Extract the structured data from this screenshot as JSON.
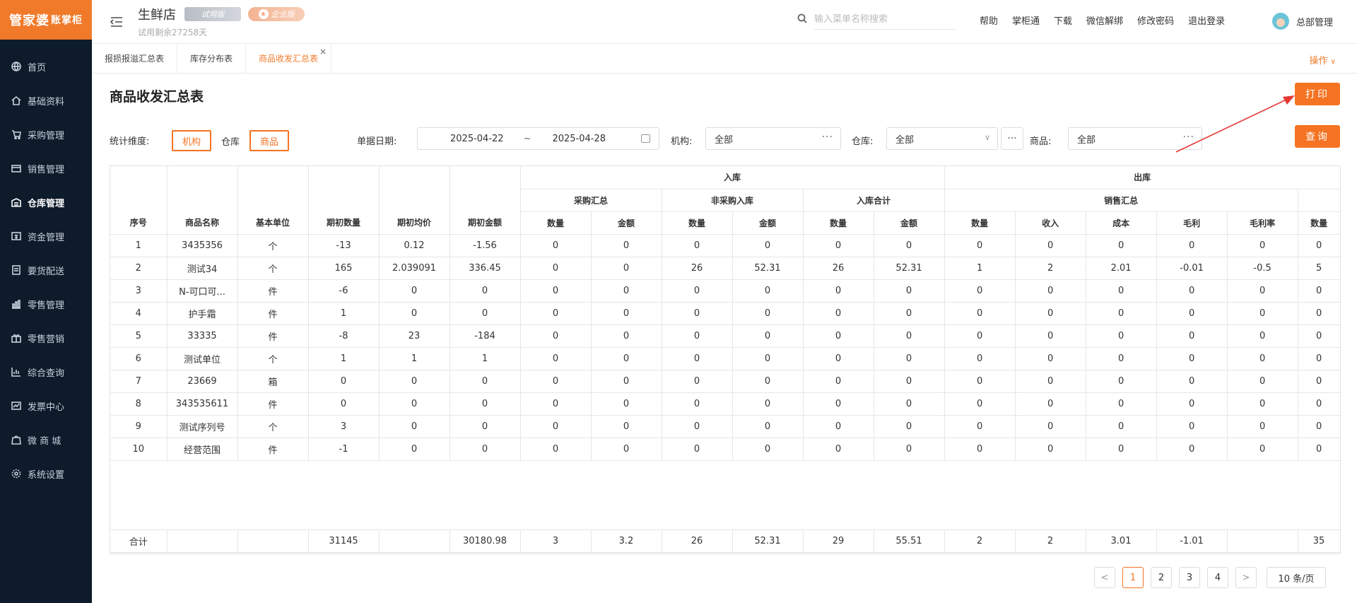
{
  "app": {
    "logo_main": "管家婆",
    "logo_sub": "账掌柜",
    "store_name": "生鲜店",
    "badge_trial": "试用版",
    "badge_pro": "企业版",
    "trial_days": "试用剩余27258天",
    "search_placeholder": "输入菜单名称搜索",
    "top_links": [
      "帮助",
      "掌柜通",
      "下载",
      "微信解绑",
      "修改密码",
      "退出登录"
    ],
    "user_name": "总部管理"
  },
  "sidebar": {
    "items": [
      {
        "label": "首页",
        "icon": "globe-icon"
      },
      {
        "label": "基础资料",
        "icon": "home-icon"
      },
      {
        "label": "采购管理",
        "icon": "cart-icon"
      },
      {
        "label": "销售管理",
        "icon": "sales-icon"
      },
      {
        "label": "仓库管理",
        "icon": "warehouse-icon"
      },
      {
        "label": "资金管理",
        "icon": "money-icon"
      },
      {
        "label": "要货配送",
        "icon": "delivery-icon"
      },
      {
        "label": "零售管理",
        "icon": "retail-icon"
      },
      {
        "label": "零售营销",
        "icon": "gift-icon"
      },
      {
        "label": "综合查询",
        "icon": "chart-icon"
      },
      {
        "label": "发票中心",
        "icon": "invoice-icon"
      },
      {
        "label": "微 商 城",
        "icon": "shop-icon"
      },
      {
        "label": "系统设置",
        "icon": "settings-icon"
      }
    ],
    "active_index": 4
  },
  "tabs": {
    "items": [
      "报损报溢汇总表",
      "库存分布表",
      "商品收发汇总表"
    ],
    "active_index": 2,
    "close_glyph": "×",
    "ops_label": "操作",
    "ops_chevron": "∨"
  },
  "page": {
    "title": "商品收发汇总表",
    "print_label": "打印",
    "query_label": "查询"
  },
  "filters": {
    "dimension_label": "统计维度:",
    "dimension_options": [
      "机构",
      "仓库",
      "商品"
    ],
    "dimension_selected": [
      0,
      2
    ],
    "date_label": "单据日期:",
    "date_start": "2025-04-22",
    "date_sep": "~",
    "date_end": "2025-04-28",
    "org_label": "机构:",
    "org_value": "全部",
    "warehouse_label": "仓库:",
    "warehouse_value": "全部",
    "product_label": "商品:",
    "product_value": "全部",
    "dots": "···"
  },
  "table": {
    "group_headers": {
      "inbound": "入库",
      "outbound": "出库",
      "purchase_summary": "采购汇总",
      "non_purchase_in": "非采购入库",
      "inbound_total": "入库合计",
      "sales_summary": "销售汇总"
    },
    "columns": [
      "序号",
      "商品名称",
      "基本单位",
      "期初数量",
      "期初均价",
      "期初金额",
      "数量",
      "金额",
      "数量",
      "金额",
      "数量",
      "金额",
      "数量",
      "收入",
      "成本",
      "毛利",
      "毛利率",
      "数量"
    ],
    "rows": [
      [
        "1",
        "3435356",
        "个",
        "-13",
        "0.12",
        "-1.56",
        "0",
        "0",
        "0",
        "0",
        "0",
        "0",
        "0",
        "0",
        "0",
        "0",
        "0",
        "0"
      ],
      [
        "2",
        "测试34",
        "个",
        "165",
        "2.039091",
        "336.45",
        "0",
        "0",
        "26",
        "52.31",
        "26",
        "52.31",
        "1",
        "2",
        "2.01",
        "-0.01",
        "-0.5",
        "5"
      ],
      [
        "3",
        "N-可口可...",
        "件",
        "-6",
        "0",
        "0",
        "0",
        "0",
        "0",
        "0",
        "0",
        "0",
        "0",
        "0",
        "0",
        "0",
        "0",
        "0"
      ],
      [
        "4",
        "护手霜",
        "件",
        "1",
        "0",
        "0",
        "0",
        "0",
        "0",
        "0",
        "0",
        "0",
        "0",
        "0",
        "0",
        "0",
        "0",
        "0"
      ],
      [
        "5",
        "33335",
        "件",
        "-8",
        "23",
        "-184",
        "0",
        "0",
        "0",
        "0",
        "0",
        "0",
        "0",
        "0",
        "0",
        "0",
        "0",
        "0"
      ],
      [
        "6",
        "测试单位",
        "个",
        "1",
        "1",
        "1",
        "0",
        "0",
        "0",
        "0",
        "0",
        "0",
        "0",
        "0",
        "0",
        "0",
        "0",
        "0"
      ],
      [
        "7",
        "23669",
        "箱",
        "0",
        "0",
        "0",
        "0",
        "0",
        "0",
        "0",
        "0",
        "0",
        "0",
        "0",
        "0",
        "0",
        "0",
        "0"
      ],
      [
        "8",
        "343535611",
        "件",
        "0",
        "0",
        "0",
        "0",
        "0",
        "0",
        "0",
        "0",
        "0",
        "0",
        "0",
        "0",
        "0",
        "0",
        "0"
      ],
      [
        "9",
        "测试序列号",
        "个",
        "3",
        "0",
        "0",
        "0",
        "0",
        "0",
        "0",
        "0",
        "0",
        "0",
        "0",
        "0",
        "0",
        "0",
        "0"
      ],
      [
        "10",
        "经营范围",
        "件",
        "-1",
        "0",
        "0",
        "0",
        "0",
        "0",
        "0",
        "0",
        "0",
        "0",
        "0",
        "0",
        "0",
        "0",
        "0"
      ]
    ],
    "totals": [
      "合计",
      "",
      "",
      "31145",
      "",
      "30180.98",
      "3",
      "3.2",
      "26",
      "52.31",
      "29",
      "55.51",
      "2",
      "2",
      "3.01",
      "-1.01",
      "",
      "35"
    ]
  },
  "pagination": {
    "pages": [
      "1",
      "2",
      "3",
      "4"
    ],
    "current": 0,
    "prev": "<",
    "next": ">",
    "page_size": "10 条/页"
  },
  "colors": {
    "accent": "#f57322",
    "sidebar_bg": "#0e1b2b",
    "logo_bg": "#f07a2a"
  }
}
